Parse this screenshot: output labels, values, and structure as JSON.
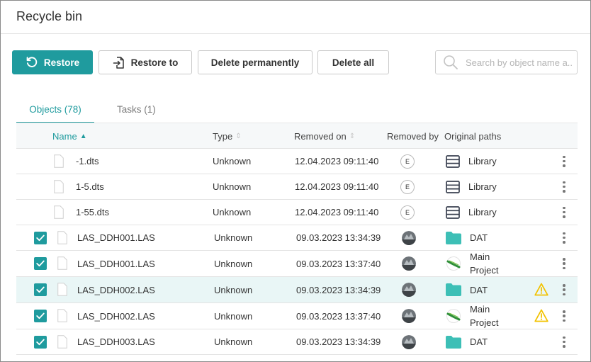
{
  "window": {
    "title": "Recycle bin"
  },
  "toolbar": {
    "restore_label": "Restore",
    "restore_to_label": "Restore to",
    "delete_permanently_label": "Delete permanently",
    "delete_all_label": "Delete all",
    "search_placeholder": "Search by object name a..."
  },
  "tabs": [
    {
      "label": "Objects (78)",
      "active": true
    },
    {
      "label": "Tasks (1)",
      "active": false
    }
  ],
  "table": {
    "columns": {
      "name": "Name",
      "type": "Type",
      "removed_on": "Removed on",
      "removed_by": "Removed by",
      "original_paths": "Original paths"
    },
    "rows": [
      {
        "name": "-1.dts",
        "type": "Unknown",
        "removed_on": "12.04.2023 09:11:40",
        "removed_by": "E",
        "path": "Library"
      },
      {
        "name": "1-5.dts",
        "type": "Unknown",
        "removed_on": "12.04.2023 09:11:40",
        "removed_by": "E",
        "path": "Library"
      },
      {
        "name": "1-55.dts",
        "type": "Unknown",
        "removed_on": "12.04.2023 09:11:40",
        "removed_by": "E",
        "path": "Library"
      },
      {
        "name": "LAS_DDH001.LAS",
        "type": "Unknown",
        "removed_on": "09.03.2023 13:34:39",
        "path": "DAT"
      },
      {
        "name": "LAS_DDH001.LAS",
        "type": "Unknown",
        "removed_on": "09.03.2023 13:37:40",
        "path_line1": "Main",
        "path_line2": "Project"
      },
      {
        "name": "LAS_DDH002.LAS",
        "type": "Unknown",
        "removed_on": "09.03.2023 13:34:39",
        "path": "DAT"
      },
      {
        "name": "LAS_DDH002.LAS",
        "type": "Unknown",
        "removed_on": "09.03.2023 13:37:40",
        "path_line1": "Main",
        "path_line2": "Project"
      },
      {
        "name": "LAS_DDH003.LAS",
        "type": "Unknown",
        "removed_on": "09.03.2023 13:34:39",
        "path": "DAT"
      }
    ]
  },
  "colors": {
    "accent": "#1f9b9e",
    "warning": "#f2c200",
    "folder": "#3dbfb6",
    "highlight_row": "#e9f6f6"
  }
}
